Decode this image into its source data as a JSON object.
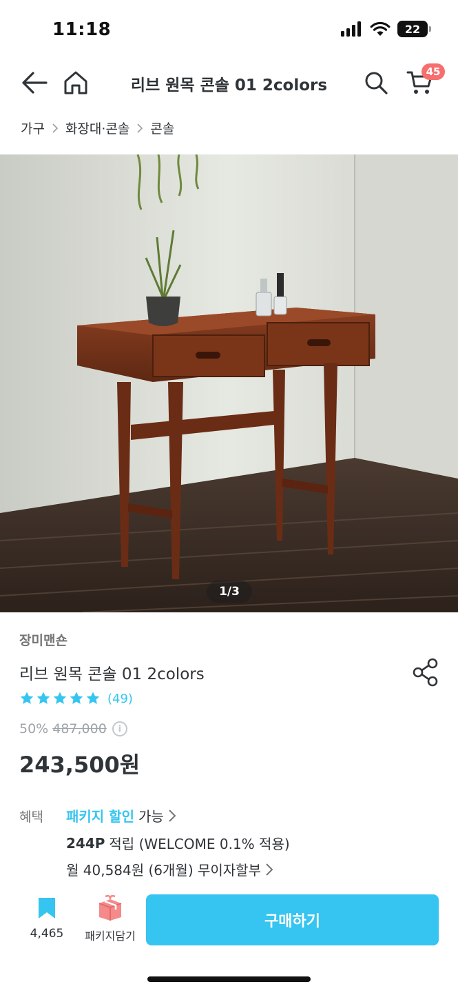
{
  "status_bar": {
    "time": "11:18",
    "battery": "22"
  },
  "nav": {
    "title": "리브 원목 콘솔 01 2colors",
    "cart_count": "45"
  },
  "breadcrumb": [
    "가구",
    "화장대·콘솔",
    "콘솔"
  ],
  "gallery": {
    "counter": "1/3"
  },
  "product": {
    "brand": "장미맨숀",
    "name": "리브 원목 콘솔 01 2colors",
    "rating_count": "(49)",
    "stars": 5,
    "discount": "50%",
    "original_price": "487,000",
    "sale_price": "243,500원"
  },
  "benefits": {
    "label": "혜택",
    "package_link": "패키지 할인",
    "package_suffix": "가능",
    "points": "244P",
    "points_text": "적립 (WELCOME 0.1% 적용)",
    "installment": "월 40,584원 (6개월) 무이자할부"
  },
  "bottom_bar": {
    "scrap_count": "4,465",
    "package_label": "패키지담기",
    "buy_label": "구매하기"
  },
  "colors": {
    "accent": "#35c5f0",
    "badge": "#f76e6e",
    "text": "#2f3438"
  }
}
